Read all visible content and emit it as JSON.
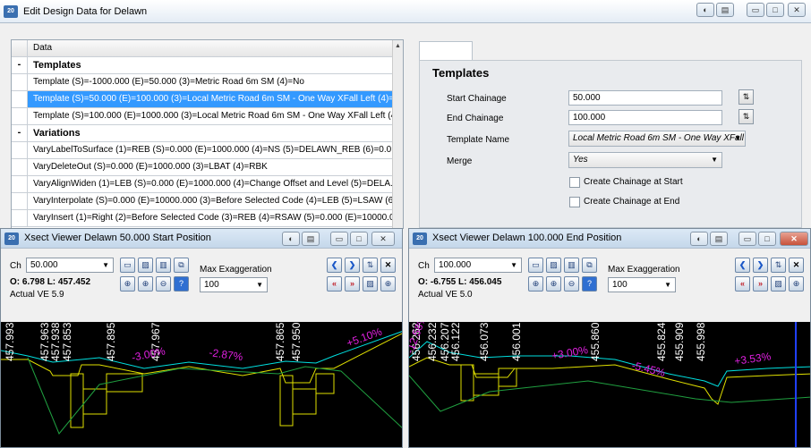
{
  "main_window": {
    "title": "Edit Design Data for Delawn",
    "app_icon": "20"
  },
  "grid": {
    "header": "Data",
    "rows": [
      {
        "type": "group",
        "marker": "-",
        "text": "Templates"
      },
      {
        "type": "item",
        "text": "Template (S)=-1000.000 (E)=50.000 (3)=Metric Road 6m SM (4)=No"
      },
      {
        "type": "selected",
        "text": "Template (S)=50.000 (E)=100.000 (3)=Local Metric Road 6m SM - One Way XFall Left (4)=..."
      },
      {
        "type": "item",
        "text": "Template (S)=100.000 (E)=1000.000 (3)=Local Metric Road 6m SM - One Way XFall Left (4..."
      },
      {
        "type": "group",
        "marker": "-",
        "text": "Variations"
      },
      {
        "type": "item",
        "text": "VaryLabelToSurface (1)=REB (S)=0.000 (E)=1000.000 (4)=NS (5)=DELAWN_REB (6)=0.0..."
      },
      {
        "type": "item",
        "text": "VaryDeleteOut (S)=0.000 (E)=1000.000 (3)=LBAT (4)=RBK"
      },
      {
        "type": "item",
        "text": "VaryAlignWiden (1)=LEB (S)=0.000 (E)=1000.000 (4)=Change Offset and Level (5)=DELA..."
      },
      {
        "type": "item",
        "text": "VaryInterpolate (S)=0.000 (E)=10000.000 (3)=Before Selected Code (4)=LEB (5)=LSAW (6..."
      },
      {
        "type": "item",
        "text": "VaryInsert (1)=Right (2)=Before Selected Code (3)=REB (4)=RSAW (5)=0.000 (E)=10000.0..."
      }
    ]
  },
  "props": {
    "section_title": "Templates",
    "start_chainage_label": "Start Chainage",
    "start_chainage_value": "50.000",
    "end_chainage_label": "End Chainage",
    "end_chainage_value": "100.000",
    "template_name_label": "Template Name",
    "template_name_value": "Local Metric Road 6m SM - One Way XFall",
    "merge_label": "Merge",
    "merge_value": "Yes",
    "create_start_label": "Create Chainage at Start",
    "create_end_label": "Create Chainage at End"
  },
  "viewer_left": {
    "title": "Xsect Viewer Delawn  50.000  Start Position",
    "ch_label": "Ch",
    "ch_value": "50.000",
    "ol_readout": "O: 6.798 L: 457.452",
    "actual_ve": "Actual VE 5.9",
    "max_exag_label": "Max Exaggeration",
    "max_exag_value": "100",
    "levels": [
      "457.993",
      "457.963",
      "457.938",
      "457.853",
      "457.895",
      "457.967",
      "457.865",
      "457.950"
    ],
    "grades": [
      "-3.00%",
      "-2.87%",
      "+5.10%"
    ]
  },
  "viewer_right": {
    "title": "Xsect Viewer Delawn  100.000 End Position",
    "ch_label": "Ch",
    "ch_value": "100.000",
    "ol_readout": "O: -6.755 L: 456.045",
    "actual_ve": "Actual VE 5.0",
    "max_exag_label": "Max Exaggeration",
    "max_exag_value": "100",
    "levels": [
      "456.262",
      "456.232",
      "456.207",
      "456.122",
      "456.073",
      "456.001",
      "455.860",
      "455.824",
      "455.909",
      "455.998"
    ],
    "grades": [
      "-12.58%",
      "+3.00%",
      "-5.45%",
      "+3.53%"
    ]
  },
  "colors": {
    "accent": "#3399ff",
    "grade_text": "#e020e0",
    "level_text": "#ffffff",
    "surface_line": "#00e0e0",
    "design_line": "#e0e000",
    "ground_line": "#20a040",
    "centre_line": "#2040ff"
  }
}
